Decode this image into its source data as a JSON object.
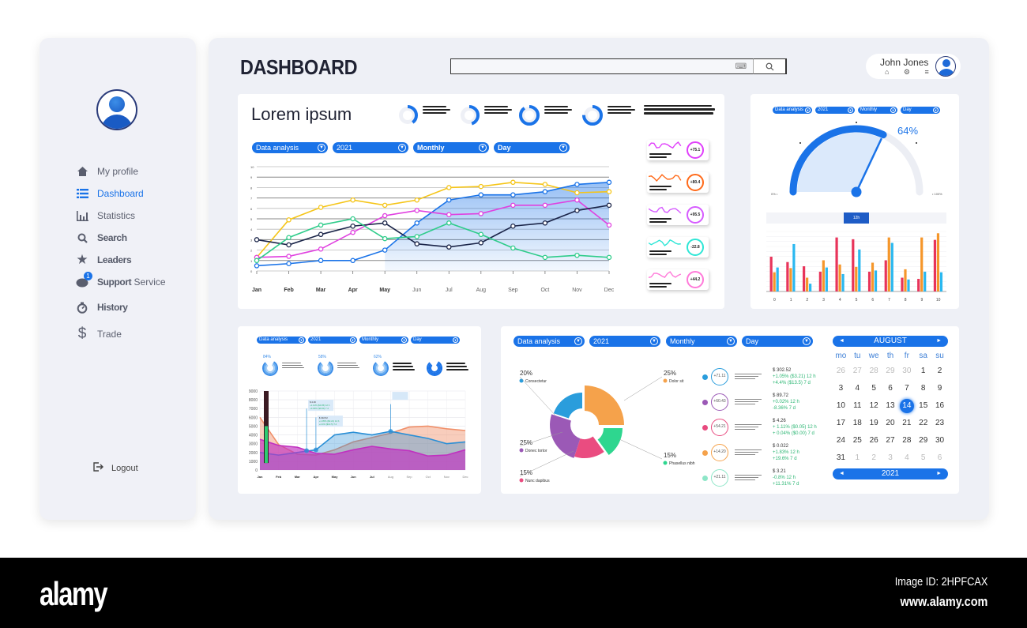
{
  "sidebar": {
    "items": [
      {
        "label": "My profile",
        "icon": "home-icon",
        "active": false
      },
      {
        "label": "Dashboard",
        "icon": "list-icon",
        "active": true
      },
      {
        "label": "Statistics",
        "icon": "bar-chart-icon",
        "active": false
      },
      {
        "label": "Search",
        "icon": "search-icon",
        "active": false
      },
      {
        "label": "Leaders",
        "icon": "star-icon",
        "active": false
      },
      {
        "label_bold": "Support",
        "label": " Service",
        "icon": "chat-icon",
        "badge": "1",
        "active": false
      },
      {
        "label": "History",
        "icon": "stopwatch-icon",
        "active": false
      },
      {
        "label": "Trade",
        "icon": "dollar-icon",
        "active": false
      }
    ],
    "logout_label": "Logout"
  },
  "header": {
    "title": "DASHBOARD",
    "search_value": "",
    "search_placeholder": "",
    "keyboard_icon": "⌨",
    "search_icon": "⌕",
    "user_name": "John Jones",
    "user_icons": "⌂ ⚙ ≡"
  },
  "filters": {
    "data_analysis": "Data analysis",
    "year": "2021",
    "period": "Monthly",
    "granularity": "Day",
    "chevron": "▼"
  },
  "line_panel": {
    "title": "Lorem ipsum",
    "kpi_donuts": [
      {
        "percent": 40
      },
      {
        "percent": 45
      },
      {
        "percent": 90
      },
      {
        "percent": 75
      }
    ],
    "spark_cards": [
      {
        "value": "+75.1",
        "color": "#e040fb"
      },
      {
        "value": "+80.4",
        "color": "#ff6a1a"
      },
      {
        "value": "+95.5",
        "color": "#d65cff"
      },
      {
        "value": "-22.8",
        "color": "#2ee6d6"
      },
      {
        "value": "+44.2",
        "color": "#ff7ad9"
      }
    ]
  },
  "gauge_panel": {
    "value_label": "64%",
    "value": 64,
    "range_tabs": [
      "",
      "",
      "",
      "12h",
      "",
      "",
      ""
    ],
    "active_tab": 3
  },
  "area_panel": {
    "donuts": [
      {
        "percent_label": "84%"
      },
      {
        "percent_label": "58%"
      },
      {
        "percent_label": "62%"
      },
      {
        "percent_label": ""
      }
    ]
  },
  "pie_panel": {
    "rows": [
      {
        "dot": "#2a9ddc",
        "ring": "+71.11",
        "price": "$ 302.52",
        "h12": "+1.05% ($3.21) 12 h",
        "d7": "+4.4% ($13.5) 7 d"
      },
      {
        "dot": "#9b59b6",
        "ring": "+60.43",
        "price": "$ 89.72",
        "h12": "+0.02% 12 h",
        "d7": "-8.36% 7 d"
      },
      {
        "dot": "#e84a7f",
        "ring": "+54.21",
        "price": "$ 4.26",
        "h12": "+ 1.11% ($0.05) 12 h",
        "d7": "+ 0.04% ($0.00) 7 d"
      },
      {
        "dot": "#f5a24b",
        "ring": "+14.20",
        "price": "$ 0.022",
        "h12": "+1.83% 12 h",
        "d7": "+19.6% 7 d"
      },
      {
        "dot": "#8ee6c8",
        "ring": "+21.11",
        "price": "$ 3.21",
        "h12": "-0.8% 12 h",
        "d7": "+11.31% 7 d"
      }
    ]
  },
  "calendar": {
    "month": "AUGUST",
    "year": "2021",
    "prev": "◄",
    "next": "►",
    "weekdays": [
      "mo",
      "tu",
      "we",
      "th",
      "fr",
      "sa",
      "su"
    ],
    "days": [
      {
        "n": "26",
        "m": true
      },
      {
        "n": "27",
        "m": true
      },
      {
        "n": "28",
        "m": true
      },
      {
        "n": "29",
        "m": true
      },
      {
        "n": "30",
        "m": true
      },
      {
        "n": "1"
      },
      {
        "n": "2"
      },
      {
        "n": "3"
      },
      {
        "n": "4"
      },
      {
        "n": "5"
      },
      {
        "n": "6"
      },
      {
        "n": "7"
      },
      {
        "n": "8"
      },
      {
        "n": "9"
      },
      {
        "n": "10"
      },
      {
        "n": "11"
      },
      {
        "n": "12"
      },
      {
        "n": "13"
      },
      {
        "n": "14",
        "sel": true
      },
      {
        "n": "15"
      },
      {
        "n": "16"
      },
      {
        "n": "17"
      },
      {
        "n": "18"
      },
      {
        "n": "19"
      },
      {
        "n": "20"
      },
      {
        "n": "21"
      },
      {
        "n": "22"
      },
      {
        "n": "23"
      },
      {
        "n": "24"
      },
      {
        "n": "25"
      },
      {
        "n": "26"
      },
      {
        "n": "27"
      },
      {
        "n": "28"
      },
      {
        "n": "29"
      },
      {
        "n": "30"
      },
      {
        "n": "31"
      },
      {
        "n": "1",
        "m": true
      },
      {
        "n": "2",
        "m": true
      },
      {
        "n": "3",
        "m": true
      },
      {
        "n": "4",
        "m": true
      },
      {
        "n": "5",
        "m": true
      },
      {
        "n": "6",
        "m": true
      }
    ]
  },
  "watermark": {
    "logo": "alamy",
    "image_id": "Image ID: 2HPFCAX",
    "url": "www.alamy.com"
  },
  "chart_data": [
    {
      "id": "main-line",
      "type": "line",
      "categories": [
        "Jan",
        "Feb",
        "Mar",
        "Apr",
        "May",
        "Jun",
        "Jul",
        "Aug",
        "Sep",
        "Oct",
        "Nov",
        "Dec"
      ],
      "ylim": [
        0,
        10
      ],
      "yticks": [
        0,
        1,
        2,
        3,
        4,
        5,
        6,
        7,
        8,
        9,
        10
      ],
      "grid": true,
      "series": [
        {
          "name": "yellow",
          "color": "#f5c518",
          "values": [
            1.3,
            4.9,
            6.1,
            6.8,
            6.3,
            6.8,
            8.0,
            8.1,
            8.5,
            8.3,
            7.5,
            7.6
          ]
        },
        {
          "name": "blue",
          "color": "#1a73e8",
          "fill": true,
          "values": [
            0.5,
            0.7,
            1.0,
            1.0,
            2.0,
            4.6,
            6.8,
            7.3,
            7.3,
            7.6,
            8.3,
            8.5
          ]
        },
        {
          "name": "magenta",
          "color": "#e040e0",
          "values": [
            1.3,
            1.4,
            2.1,
            3.7,
            5.3,
            5.8,
            5.4,
            5.5,
            6.3,
            6.3,
            6.8,
            4.4
          ]
        },
        {
          "name": "navy",
          "color": "#1a2448",
          "values": [
            3.0,
            2.5,
            3.5,
            4.3,
            4.6,
            2.6,
            2.3,
            2.7,
            4.3,
            4.6,
            5.8,
            6.3
          ]
        },
        {
          "name": "green",
          "color": "#2ecc8a",
          "values": [
            1.0,
            3.2,
            4.4,
            5.0,
            3.1,
            3.3,
            4.6,
            3.5,
            2.2,
            1.3,
            1.5,
            1.3
          ]
        }
      ]
    },
    {
      "id": "gauge",
      "type": "gauge",
      "value": 64,
      "min_label": "0%",
      "max_label": "100%"
    },
    {
      "id": "group-bars",
      "type": "bar",
      "categories": [
        "0",
        "1",
        "2",
        "3",
        "4",
        "5",
        "6",
        "7",
        "8",
        "9",
        "10"
      ],
      "ylim": [
        0,
        100
      ],
      "series": [
        {
          "name": "red",
          "color": "#e8345a",
          "values": [
            58,
            49,
            42,
            33,
            90,
            87,
            33,
            52,
            23,
            21,
            86
          ]
        },
        {
          "name": "orange",
          "color": "#f5962a",
          "values": [
            32,
            39,
            23,
            52,
            45,
            41,
            48,
            90,
            37,
            90,
            97
          ]
        },
        {
          "name": "cyan",
          "color": "#2ab8f0",
          "values": [
            40,
            79,
            13,
            40,
            29,
            70,
            35,
            81,
            20,
            33,
            32
          ]
        }
      ]
    },
    {
      "id": "area-chart",
      "type": "area",
      "categories": [
        "Jan",
        "Feb",
        "Mar",
        "Apr",
        "May",
        "Jun",
        "Jul",
        "Aug",
        "Sep",
        "Oct",
        "Nov",
        "Dec"
      ],
      "ylim": [
        0,
        9000
      ],
      "yticks": [
        0,
        1000,
        2000,
        3000,
        4000,
        5000,
        6000,
        7000,
        8000,
        9000
      ],
      "series": [
        {
          "name": "orange",
          "color": "#f0906a",
          "values": [
            6000,
            2900,
            1800,
            1700,
            2300,
            3200,
            3700,
            4200,
            4900,
            5000,
            4700,
            4500
          ]
        },
        {
          "name": "blue",
          "color": "#2a8fd6",
          "values": [
            2000,
            1700,
            2000,
            2300,
            4000,
            4300,
            4000,
            4400,
            4000,
            3600,
            3000,
            3200
          ]
        },
        {
          "name": "magenta",
          "color": "#c030c0",
          "values": [
            3500,
            2800,
            2600,
            1900,
            1800,
            2300,
            2700,
            2400,
            2200,
            1600,
            1700,
            2300
          ]
        }
      ],
      "tooltips": [
        {
          "x": "Mar",
          "lines": [
            "$ 4.26",
            "+1.11% ($0.05) 12 h",
            "+0.04% ($0.00) 7 d"
          ]
        },
        {
          "x": "Apr",
          "lines": [
            "$ 302.52",
            "+1.05% ($3.21) 12 h",
            "+4.4% ($13.5) 7 d"
          ]
        }
      ]
    },
    {
      "id": "pie",
      "type": "pie",
      "slices": [
        {
          "label": "Consectetur",
          "percent": 20,
          "color": "#2a9ddc"
        },
        {
          "label": "Dolor sit",
          "percent": 25,
          "color": "#f5a24b"
        },
        {
          "label": "Phasellus nibh",
          "percent": 15,
          "color": "#2ed68f"
        },
        {
          "label": "Nunc dapibus",
          "percent": 15,
          "color": "#ea4c80"
        },
        {
          "label": "Donec tortor",
          "percent": 25,
          "color": "#9b59b6"
        }
      ]
    }
  ]
}
